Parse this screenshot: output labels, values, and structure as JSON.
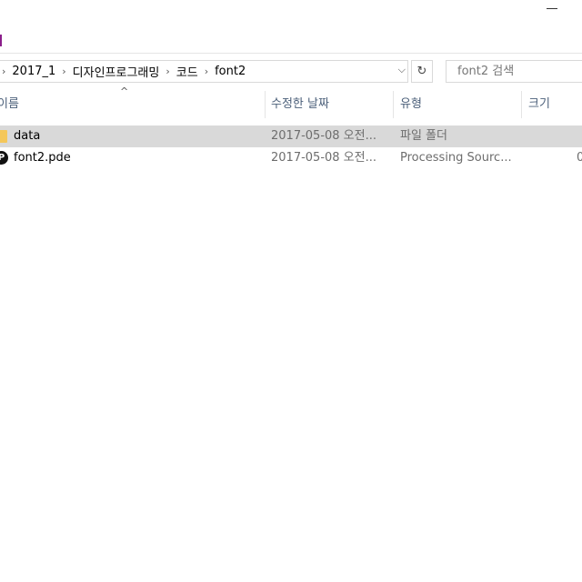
{
  "window": {
    "minimize_icon": "minimize-icon",
    "accent_color": "#8b1e8b"
  },
  "address": {
    "crumbs": [
      "2017_1",
      "디자인프로그래밍",
      "코드",
      "font2"
    ],
    "refresh_icon": "refresh-icon"
  },
  "search": {
    "placeholder": "font2 검색"
  },
  "columns": [
    "이름",
    "수정한 날짜",
    "유형",
    "크기"
  ],
  "rows": [
    {
      "name": "data",
      "date": "2017-05-08 오전...",
      "type": "파일 폴더",
      "size": "",
      "icon": "folder-icon",
      "selected": true
    },
    {
      "name": "font2.pde",
      "date": "2017-05-08 오전...",
      "type": "Processing Sourc...",
      "size": "0",
      "icon": "processing-file-icon",
      "selected": false
    }
  ]
}
